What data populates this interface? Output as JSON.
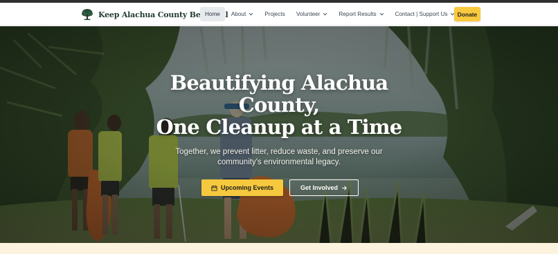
{
  "nav": {
    "brand_name": "Keep Alachua County Beautiful",
    "items": [
      {
        "label": "Home",
        "active": true,
        "dropdown": false
      },
      {
        "label": "About",
        "active": false,
        "dropdown": true
      },
      {
        "label": "Projects",
        "active": false,
        "dropdown": false
      },
      {
        "label": "Volunteer",
        "active": false,
        "dropdown": true
      },
      {
        "label": "Report Results",
        "active": false,
        "dropdown": true
      },
      {
        "label": "Contact | Support Us",
        "active": false,
        "dropdown": true
      }
    ],
    "donate_label": "Donate"
  },
  "hero": {
    "title_lines": [
      "Beautifying Alachua",
      "County,",
      "One Cleanup at a Time"
    ],
    "subtitle_lines": [
      "Together, we prevent litter, reduce waste, and preserve our",
      "community's environmental legacy."
    ],
    "primary_button": {
      "label": "Upcoming Events",
      "icon": "calendar-icon"
    },
    "secondary_button": {
      "label": "Get Involved",
      "icon": "arrow-right-icon"
    }
  },
  "colors": {
    "accent": "#f6c83e",
    "brand_text": "#1f3b2d",
    "strip": "#fbf3de"
  }
}
